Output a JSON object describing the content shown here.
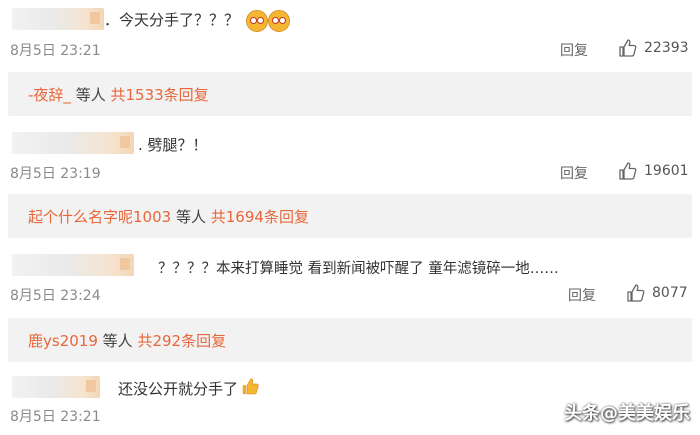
{
  "comments": [
    {
      "text": "．今天分手了？？？",
      "date": "8月5日 23:21",
      "reply": "回复",
      "likes": "22393",
      "replies_box": {
        "user": "-夜辞_",
        "mid": "等人",
        "count": "共1533条回复"
      }
    },
    {
      "text": ". 劈腿？！",
      "date": "8月5日 23:19",
      "reply": "回复",
      "likes": "19601",
      "replies_box": {
        "user": "起个什么名字呢1003",
        "mid": "等人",
        "count": "共1694条回复"
      }
    },
    {
      "text": "？？？？本来打算睡觉 看到新闻被吓醒了 童年滤镜碎一地……",
      "date": "8月5日 23:24",
      "reply": "回复",
      "likes": "8077",
      "replies_box": {
        "user": "鹿ys2019",
        "mid": "等人",
        "count": "共292条回复"
      }
    },
    {
      "text": "还没公开就分手了",
      "date": "8月5日 23:21"
    }
  ],
  "watermark": "头条@美美娱乐",
  "icons": {
    "like": "thumbs-up-icon",
    "emoji1": "cat-face-emoji-icon",
    "emoji2": "thumbs-up-emoji-icon"
  },
  "colors": {
    "accent": "#e8663a",
    "reply_bg": "#f2f2f2",
    "meta": "#8a8a8a"
  }
}
